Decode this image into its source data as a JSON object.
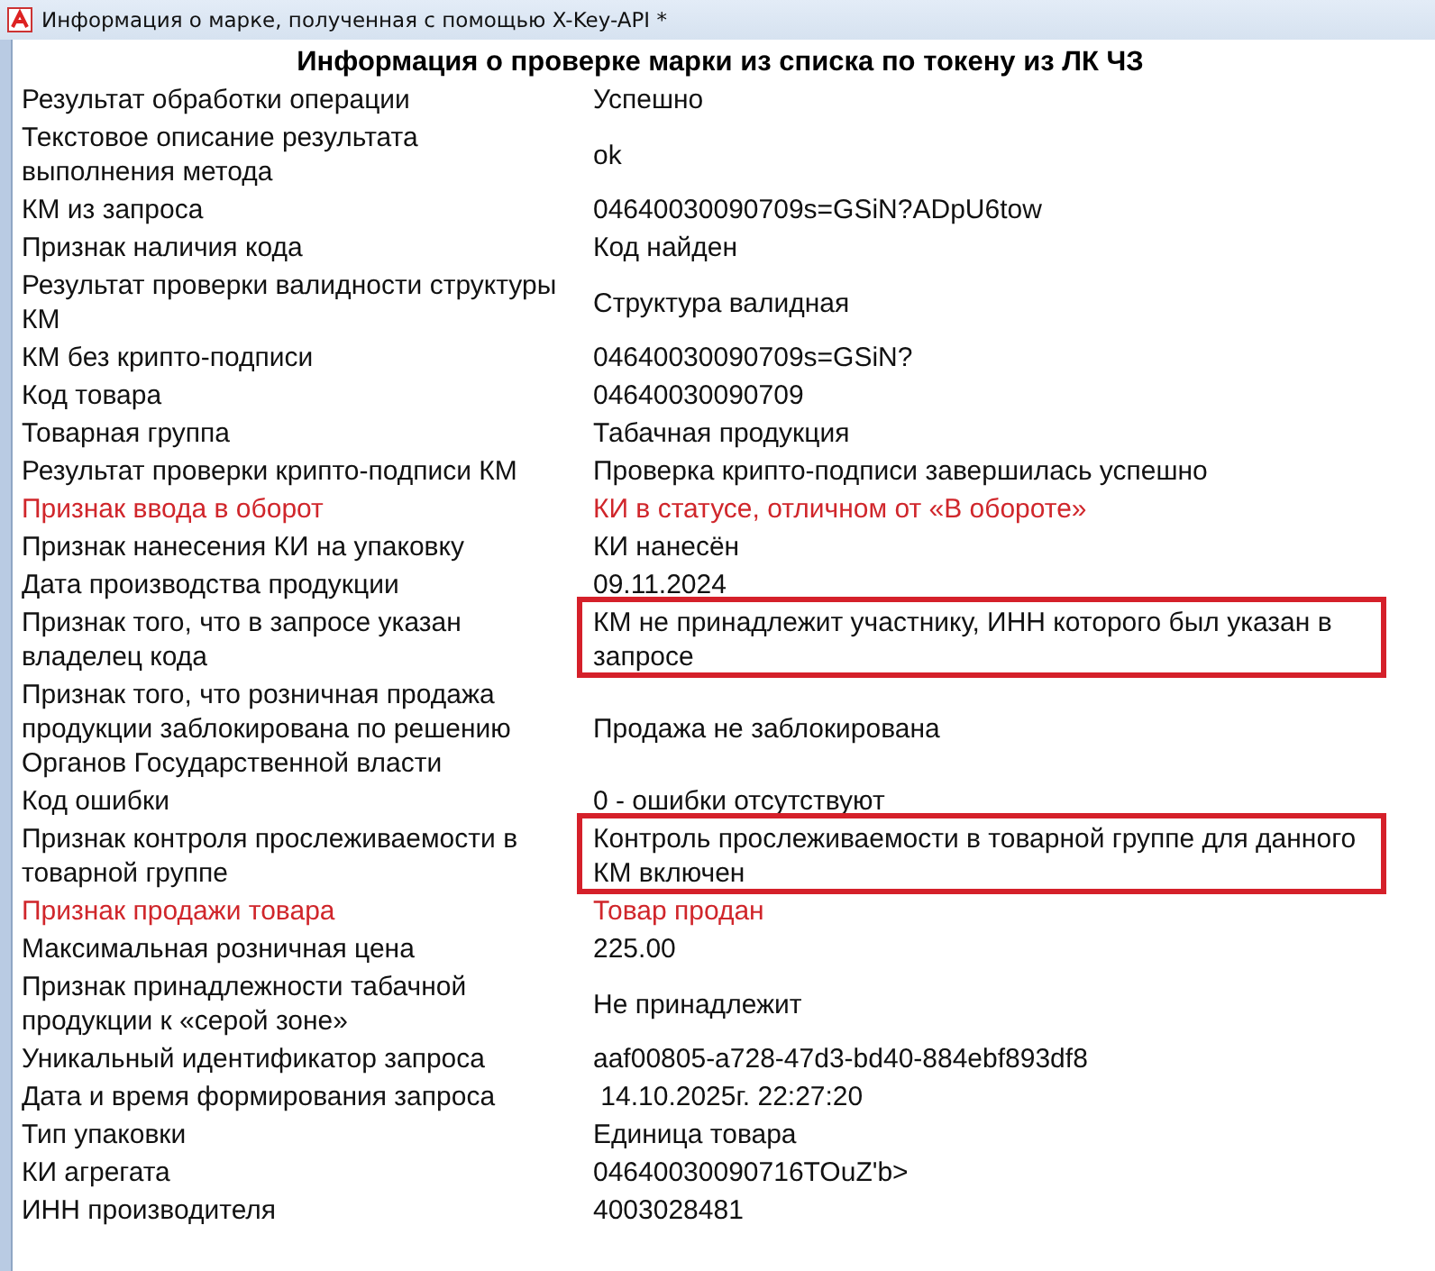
{
  "window": {
    "title": "Информация о марке, полученная с помощью X-Key-API *"
  },
  "heading": "Информация о проверке марки из списка по токену из ЛК ЧЗ",
  "rows": [
    {
      "label": "Результат обработки операции",
      "value": "Успешно",
      "alert": false,
      "highlighted": false
    },
    {
      "label": "Текстовое описание результата выполнения метода",
      "value": "ok",
      "alert": false,
      "highlighted": false
    },
    {
      "label": "КМ из запроса",
      "value": "04640030090709s=GSiN?ADpU6tow",
      "alert": false,
      "highlighted": false
    },
    {
      "label": "Признак наличия кода",
      "value": "Код найден",
      "alert": false,
      "highlighted": false
    },
    {
      "label": "Результат проверки валидности структуры КМ",
      "value": "Структура валидная",
      "alert": false,
      "highlighted": false
    },
    {
      "label": "КМ без крипто-подписи",
      "value": "04640030090709s=GSiN?",
      "alert": false,
      "highlighted": false
    },
    {
      "label": "Код товара",
      "value": "04640030090709",
      "alert": false,
      "highlighted": false
    },
    {
      "label": "Товарная группа",
      "value": "Табачная продукция",
      "alert": false,
      "highlighted": false
    },
    {
      "label": "Результат проверки крипто-подписи КМ",
      "value": "Проверка крипто-подписи завершилась успешно",
      "alert": false,
      "highlighted": false
    },
    {
      "label": "Признак ввода в оборот",
      "value": "КИ в статусе, отличном от «В обороте»",
      "alert": true,
      "highlighted": false
    },
    {
      "label": "Признак нанесения КИ на упаковку",
      "value": "КИ нанесён",
      "alert": false,
      "highlighted": false
    },
    {
      "label": "Дата производства продукции",
      "value": "09.11.2024",
      "alert": false,
      "highlighted": false
    },
    {
      "label": "Признак того, что в запросе указан владелец кода",
      "value": "КМ не принадлежит участнику, ИНН которого был указан в запросе",
      "alert": false,
      "highlighted": true
    },
    {
      "label": "Признак того, что розничная продажа продукции заблокирована по решению Органов Государственной власти",
      "value": "Продажа не заблокирована",
      "alert": false,
      "highlighted": false
    },
    {
      "label": "Код ошибки",
      "value": "0 - ошибки отсутствуют",
      "alert": false,
      "highlighted": false
    },
    {
      "label": "Признак контроля прослеживаемости в товарной группе",
      "value": "Контроль прослеживаемости в товарной группе для данного КМ включен",
      "alert": false,
      "highlighted": true
    },
    {
      "label": "Признак продажи товара",
      "value": "Товар продан",
      "alert": true,
      "highlighted": false
    },
    {
      "label": "Максимальная розничная цена",
      "value": "225.00",
      "alert": false,
      "highlighted": false
    },
    {
      "label": "Признак принадлежности табачной продукции к «серой зоне»",
      "value": "Не принадлежит",
      "alert": false,
      "highlighted": false
    },
    {
      "label": "Уникальный идентификатор запроса",
      "value": "aaf00805-a728-47d3-bd40-884ebf893df8",
      "alert": false,
      "highlighted": false
    },
    {
      "label": "Дата и время формирования запроса",
      "value": " 14.10.2025г. 22:27:20",
      "alert": false,
      "highlighted": false
    },
    {
      "label": "Тип упаковки",
      "value": "Единица товара",
      "alert": false,
      "highlighted": false
    },
    {
      "label": "КИ агрегата",
      "value": "04640030090716TOuZ'b>",
      "alert": false,
      "highlighted": false
    },
    {
      "label": "ИНН производителя",
      "value": "4003028481",
      "alert": false,
      "highlighted": false
    }
  ]
}
